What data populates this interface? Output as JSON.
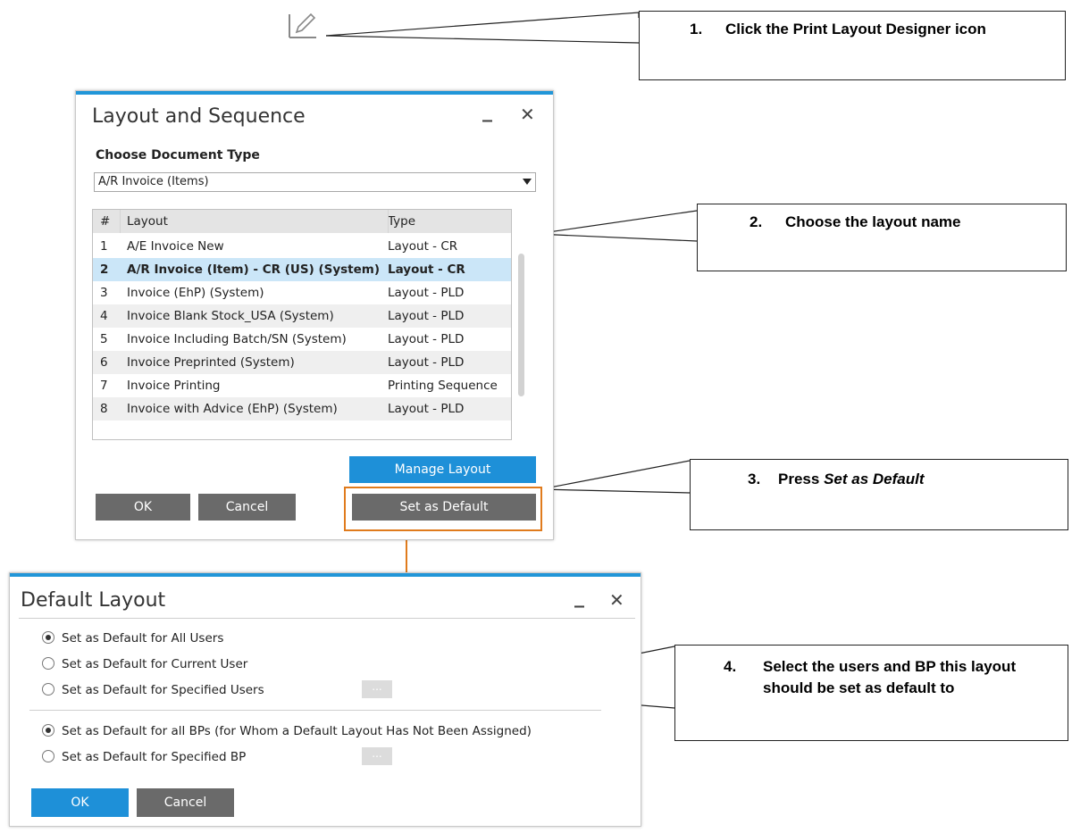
{
  "callouts": [
    {
      "num": "1.",
      "text": "Click the Print Layout Designer icon"
    },
    {
      "num": "2.",
      "text": "Choose the layout name"
    },
    {
      "num": "3.",
      "text": "Press",
      "emph": "Set as Default"
    },
    {
      "num": "4.",
      "text": "Select the users and BP this layout should be set as default to"
    }
  ],
  "layout_dialog": {
    "title": "Layout and Sequence",
    "minimize": "_",
    "close": "✕",
    "doc_type_label": "Choose Document Type",
    "doc_type_value": "A/R Invoice (Items)",
    "columns": [
      "#",
      "Layout",
      "Type"
    ],
    "rows": [
      {
        "num": "1",
        "layout": "A/E Invoice New",
        "type": "Layout - CR"
      },
      {
        "num": "2",
        "layout": "A/R Invoice (Item) - CR (US) (System)",
        "type": "Layout - CR"
      },
      {
        "num": "3",
        "layout": "Invoice (EhP) (System)",
        "type": "Layout - PLD"
      },
      {
        "num": "4",
        "layout": "Invoice Blank Stock_USA (System)",
        "type": "Layout - PLD"
      },
      {
        "num": "5",
        "layout": "Invoice Including Batch/SN (System)",
        "type": "Layout - PLD"
      },
      {
        "num": "6",
        "layout": "Invoice Preprinted (System)",
        "type": "Layout - PLD"
      },
      {
        "num": "7",
        "layout": "Invoice Printing",
        "type": "Printing Sequence"
      },
      {
        "num": "8",
        "layout": "Invoice with Advice (EhP) (System)",
        "type": "Layout - PLD"
      }
    ],
    "selected_row": "2",
    "manage_layout": "Manage Layout",
    "ok": "OK",
    "cancel": "Cancel",
    "set_default": "Set as Default"
  },
  "default_dialog": {
    "title": "Default Layout",
    "minimize": "_",
    "close": "✕",
    "user_options": [
      "Set as Default for All Users",
      "Set as Default for Current User",
      "Set as Default for Specified Users"
    ],
    "user_selected": "Set as Default for All Users",
    "bp_options": [
      "Set as Default for all BPs (for Whom a Default Layout Has Not Been Assigned)",
      "Set as Default for Specified BP"
    ],
    "bp_selected": "Set as Default for all BPs (for Whom a Default Layout Has Not Been Assigned)",
    "ellipsis": "...",
    "ok": "OK",
    "cancel": "Cancel"
  },
  "colors": {
    "accent": "#2196d8",
    "highlight_box": "#e07b1d",
    "button_gray": "#6a6a6a",
    "selected_row": "#cbe6f8"
  },
  "icons": [
    "pencil-icon",
    "close-icon",
    "minimize-icon",
    "dropdown-arrow-icon",
    "arrow-down-icon"
  ]
}
